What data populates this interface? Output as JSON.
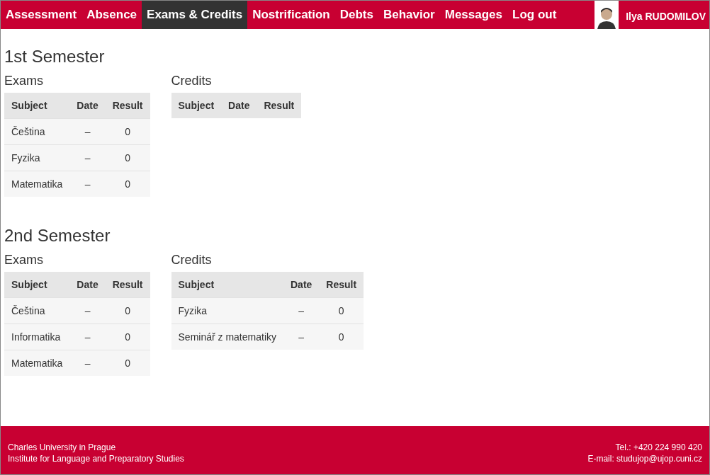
{
  "nav": {
    "items": [
      {
        "label": "Assessment",
        "selected": false
      },
      {
        "label": "Absence",
        "selected": false
      },
      {
        "label": "Exams & Credits",
        "selected": true
      },
      {
        "label": "Nostrification",
        "selected": false
      },
      {
        "label": "Debts",
        "selected": false
      },
      {
        "label": "Behavior",
        "selected": false
      },
      {
        "label": "Messages",
        "selected": false
      },
      {
        "label": "Log out",
        "selected": false
      }
    ],
    "user": "Ilya RUDOMILOV"
  },
  "semesters": [
    {
      "title": "1st Semester",
      "tables": [
        {
          "title": "Exams",
          "columns": [
            "Subject",
            "Date",
            "Result"
          ],
          "rows": [
            [
              "Čeština",
              "–",
              "0"
            ],
            [
              "Fyzika",
              "–",
              "0"
            ],
            [
              "Matematika",
              "–",
              "0"
            ]
          ]
        },
        {
          "title": "Credits",
          "columns": [
            "Subject",
            "Date",
            "Result"
          ]
        }
      ]
    },
    {
      "title": "2nd Semester",
      "tables": [
        {
          "title": "Exams",
          "columns": [
            "Subject",
            "Date",
            "Result"
          ],
          "rows": [
            [
              "Čeština",
              "–",
              "0"
            ],
            [
              "Informatika",
              "–",
              "0"
            ],
            [
              "Matematika",
              "–",
              "0"
            ]
          ]
        },
        {
          "title": "Credits",
          "columns": [
            "Subject",
            "Date",
            "Result"
          ],
          "rows": [
            [
              "Fyzika",
              "–",
              "0"
            ],
            [
              "Seminář z matematiky",
              "–",
              "0"
            ]
          ]
        }
      ]
    }
  ],
  "footer": {
    "left": [
      "Charles University in Prague",
      "Institute for Language and Preparatory Studies"
    ],
    "right": [
      "Tel.: +420 224 990 420",
      "E-mail: studujop@ujop.cuni.cz"
    ]
  }
}
